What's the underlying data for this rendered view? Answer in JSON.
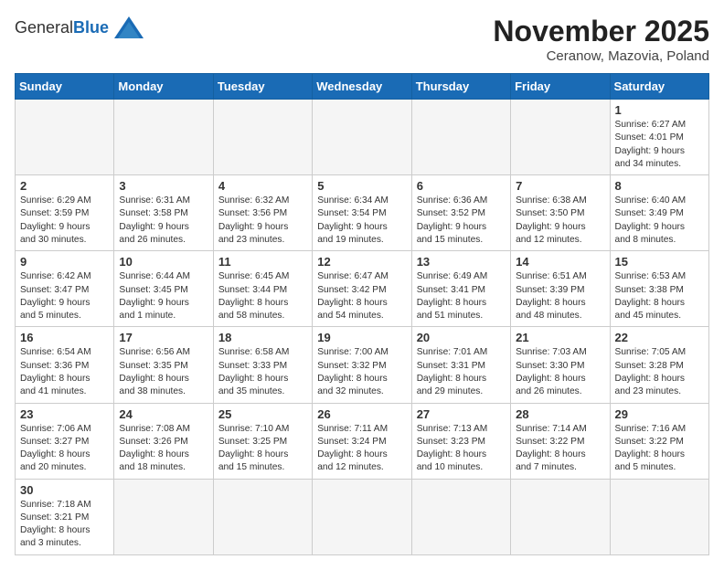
{
  "logo": {
    "text_general": "General",
    "text_blue": "Blue"
  },
  "title": "November 2025",
  "subtitle": "Ceranow, Mazovia, Poland",
  "days_of_week": [
    "Sunday",
    "Monday",
    "Tuesday",
    "Wednesday",
    "Thursday",
    "Friday",
    "Saturday"
  ],
  "weeks": [
    [
      {
        "day": "",
        "info": ""
      },
      {
        "day": "",
        "info": ""
      },
      {
        "day": "",
        "info": ""
      },
      {
        "day": "",
        "info": ""
      },
      {
        "day": "",
        "info": ""
      },
      {
        "day": "",
        "info": ""
      },
      {
        "day": "1",
        "info": "Sunrise: 6:27 AM\nSunset: 4:01 PM\nDaylight: 9 hours\nand 34 minutes."
      }
    ],
    [
      {
        "day": "2",
        "info": "Sunrise: 6:29 AM\nSunset: 3:59 PM\nDaylight: 9 hours\nand 30 minutes."
      },
      {
        "day": "3",
        "info": "Sunrise: 6:31 AM\nSunset: 3:58 PM\nDaylight: 9 hours\nand 26 minutes."
      },
      {
        "day": "4",
        "info": "Sunrise: 6:32 AM\nSunset: 3:56 PM\nDaylight: 9 hours\nand 23 minutes."
      },
      {
        "day": "5",
        "info": "Sunrise: 6:34 AM\nSunset: 3:54 PM\nDaylight: 9 hours\nand 19 minutes."
      },
      {
        "day": "6",
        "info": "Sunrise: 6:36 AM\nSunset: 3:52 PM\nDaylight: 9 hours\nand 15 minutes."
      },
      {
        "day": "7",
        "info": "Sunrise: 6:38 AM\nSunset: 3:50 PM\nDaylight: 9 hours\nand 12 minutes."
      },
      {
        "day": "8",
        "info": "Sunrise: 6:40 AM\nSunset: 3:49 PM\nDaylight: 9 hours\nand 8 minutes."
      }
    ],
    [
      {
        "day": "9",
        "info": "Sunrise: 6:42 AM\nSunset: 3:47 PM\nDaylight: 9 hours\nand 5 minutes."
      },
      {
        "day": "10",
        "info": "Sunrise: 6:44 AM\nSunset: 3:45 PM\nDaylight: 9 hours\nand 1 minute."
      },
      {
        "day": "11",
        "info": "Sunrise: 6:45 AM\nSunset: 3:44 PM\nDaylight: 8 hours\nand 58 minutes."
      },
      {
        "day": "12",
        "info": "Sunrise: 6:47 AM\nSunset: 3:42 PM\nDaylight: 8 hours\nand 54 minutes."
      },
      {
        "day": "13",
        "info": "Sunrise: 6:49 AM\nSunset: 3:41 PM\nDaylight: 8 hours\nand 51 minutes."
      },
      {
        "day": "14",
        "info": "Sunrise: 6:51 AM\nSunset: 3:39 PM\nDaylight: 8 hours\nand 48 minutes."
      },
      {
        "day": "15",
        "info": "Sunrise: 6:53 AM\nSunset: 3:38 PM\nDaylight: 8 hours\nand 45 minutes."
      }
    ],
    [
      {
        "day": "16",
        "info": "Sunrise: 6:54 AM\nSunset: 3:36 PM\nDaylight: 8 hours\nand 41 minutes."
      },
      {
        "day": "17",
        "info": "Sunrise: 6:56 AM\nSunset: 3:35 PM\nDaylight: 8 hours\nand 38 minutes."
      },
      {
        "day": "18",
        "info": "Sunrise: 6:58 AM\nSunset: 3:33 PM\nDaylight: 8 hours\nand 35 minutes."
      },
      {
        "day": "19",
        "info": "Sunrise: 7:00 AM\nSunset: 3:32 PM\nDaylight: 8 hours\nand 32 minutes."
      },
      {
        "day": "20",
        "info": "Sunrise: 7:01 AM\nSunset: 3:31 PM\nDaylight: 8 hours\nand 29 minutes."
      },
      {
        "day": "21",
        "info": "Sunrise: 7:03 AM\nSunset: 3:30 PM\nDaylight: 8 hours\nand 26 minutes."
      },
      {
        "day": "22",
        "info": "Sunrise: 7:05 AM\nSunset: 3:28 PM\nDaylight: 8 hours\nand 23 minutes."
      }
    ],
    [
      {
        "day": "23",
        "info": "Sunrise: 7:06 AM\nSunset: 3:27 PM\nDaylight: 8 hours\nand 20 minutes."
      },
      {
        "day": "24",
        "info": "Sunrise: 7:08 AM\nSunset: 3:26 PM\nDaylight: 8 hours\nand 18 minutes."
      },
      {
        "day": "25",
        "info": "Sunrise: 7:10 AM\nSunset: 3:25 PM\nDaylight: 8 hours\nand 15 minutes."
      },
      {
        "day": "26",
        "info": "Sunrise: 7:11 AM\nSunset: 3:24 PM\nDaylight: 8 hours\nand 12 minutes."
      },
      {
        "day": "27",
        "info": "Sunrise: 7:13 AM\nSunset: 3:23 PM\nDaylight: 8 hours\nand 10 minutes."
      },
      {
        "day": "28",
        "info": "Sunrise: 7:14 AM\nSunset: 3:22 PM\nDaylight: 8 hours\nand 7 minutes."
      },
      {
        "day": "29",
        "info": "Sunrise: 7:16 AM\nSunset: 3:22 PM\nDaylight: 8 hours\nand 5 minutes."
      }
    ],
    [
      {
        "day": "30",
        "info": "Sunrise: 7:18 AM\nSunset: 3:21 PM\nDaylight: 8 hours\nand 3 minutes."
      },
      {
        "day": "",
        "info": ""
      },
      {
        "day": "",
        "info": ""
      },
      {
        "day": "",
        "info": ""
      },
      {
        "day": "",
        "info": ""
      },
      {
        "day": "",
        "info": ""
      },
      {
        "day": "",
        "info": ""
      }
    ]
  ]
}
